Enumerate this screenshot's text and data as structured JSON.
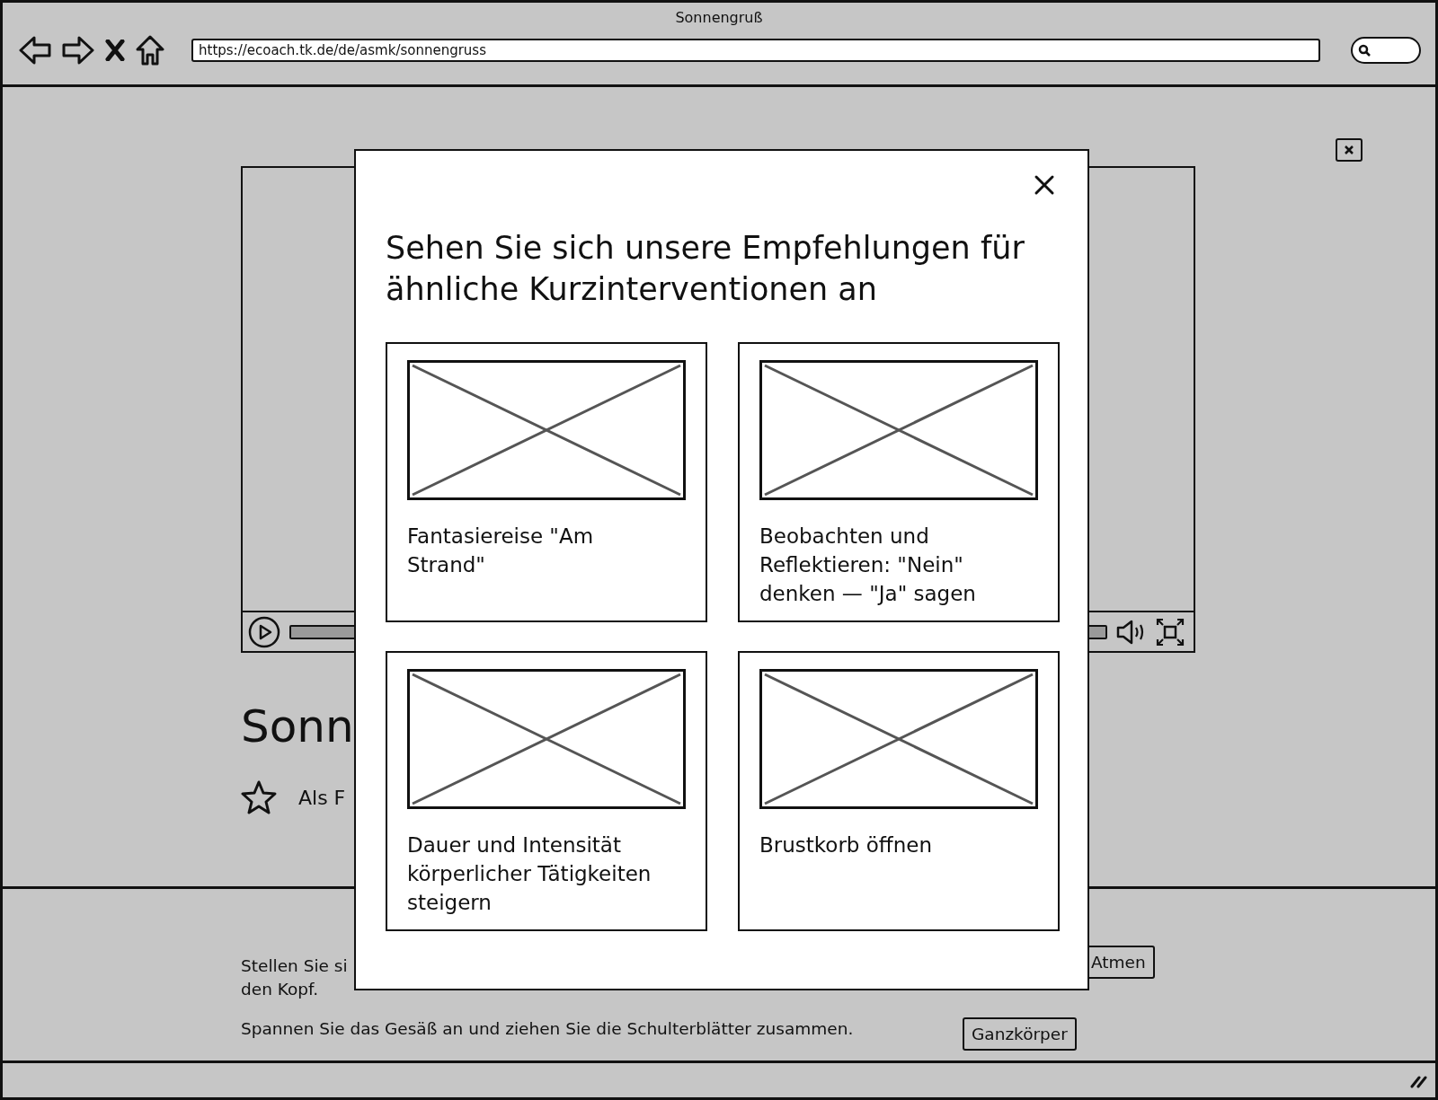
{
  "window": {
    "title": "Sonnengruß",
    "url": "https://ecoach.tk.de/de/asmk/sonnengruss"
  },
  "page": {
    "heading": "Sonn",
    "favorite": {
      "label": "Als F"
    },
    "instructions": [
      {
        "lines": [
          "Stellen Sie si",
          "den Kopf."
        ],
        "button": "Atmen"
      },
      {
        "lines": [
          "Spannen Sie das Gesäß an und ziehen Sie die Schulterblätter zusammen."
        ],
        "button": "Ganzkörper"
      }
    ]
  },
  "modal": {
    "title": "Sehen Sie sich unsere Empfehlungen für ähnliche Kurzinterventionen an",
    "cards": [
      {
        "title": "Fantasiereise \"Am Strand\""
      },
      {
        "title": "Beobachten und Reflektieren: \"Nein\" denken — \"Ja\" sagen"
      },
      {
        "title": "Dauer und Intensität körperlicher Tätigkeiten steigern"
      },
      {
        "title": "Brustkorb öffnen"
      }
    ]
  }
}
